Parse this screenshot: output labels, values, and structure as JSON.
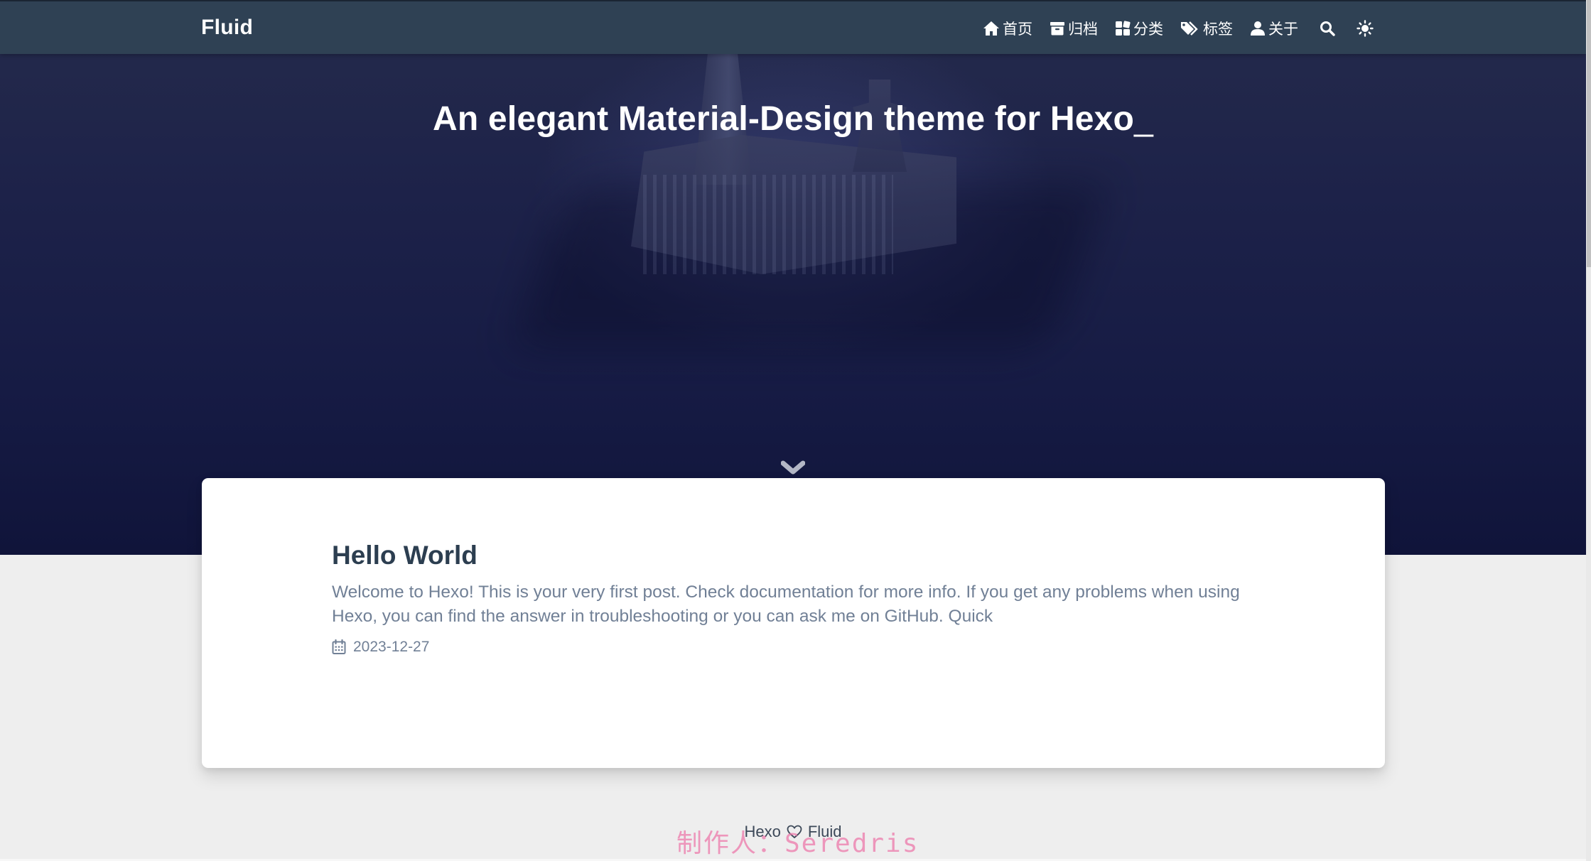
{
  "navbar": {
    "brand": "Fluid",
    "items": [
      {
        "label": "首页",
        "icon": "home-icon"
      },
      {
        "label": "归档",
        "icon": "archive-icon"
      },
      {
        "label": "分类",
        "icon": "category-icon"
      },
      {
        "label": "标签",
        "icon": "tag-icon"
      },
      {
        "label": "关于",
        "icon": "user-icon"
      }
    ],
    "search_icon": "search-icon",
    "theme_icon": "sun-icon"
  },
  "banner": {
    "slogan": "An elegant Material-Design theme for Hexo",
    "cursor": "_",
    "scroll_icon": "chevron-down-icon"
  },
  "posts": [
    {
      "title": "Hello World",
      "excerpt": "Welcome to Hexo! This is your very first post. Check documentation for more info. If you get any problems when using Hexo, you can find the answer in troubleshooting or you can ask me on GitHub. Quick",
      "date": "2023-12-27",
      "date_icon": "calendar-icon"
    }
  ],
  "footer": {
    "left": "Hexo",
    "right": "Fluid",
    "heart_icon": "heart-icon",
    "watermark": "制作人：Seredris"
  },
  "colors": {
    "navbar": "#2f4154",
    "banner": "#1d2249",
    "card": "#ffffff",
    "title": "#2c3e50",
    "text_muted": "#718096",
    "background": "#eeeeee"
  }
}
